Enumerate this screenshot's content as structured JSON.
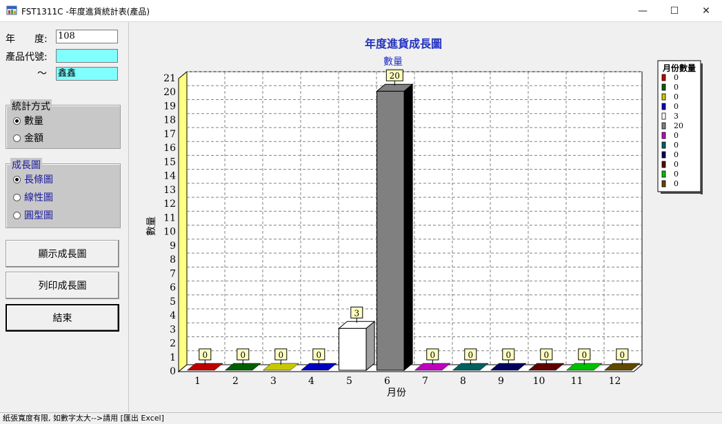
{
  "window": {
    "title": "FST1311C -年度進貨統計表(產品)",
    "minimize": "—",
    "maximize": "☐",
    "close": "✕"
  },
  "form": {
    "year_label": "年　　度:",
    "year_value": "108",
    "product_code_label": "產品代號:",
    "product_code_from": "",
    "tilde": "～",
    "product_code_to": "鑫鑫"
  },
  "stat_method": {
    "title": "統計方式",
    "options": [
      "數量",
      "金額"
    ],
    "selected": 0
  },
  "growth_chart": {
    "title": "成長圖",
    "options": [
      "長條圖",
      "線性圖",
      "圓型圖"
    ],
    "selected": 0
  },
  "buttons": {
    "show": "顯示成長圖",
    "print": "列印成長圖",
    "end": "結束"
  },
  "status": "紙張寬度有限, 如數字太大-->請用 [匯出 Excel]",
  "chart_data": {
    "type": "bar",
    "title": "年度進貨成長圖",
    "subtitle": "數量",
    "xlabel": "月份",
    "ylabel": "數量",
    "ylim": [
      0,
      21
    ],
    "categories": [
      "1",
      "2",
      "3",
      "4",
      "5",
      "6",
      "7",
      "8",
      "9",
      "10",
      "11",
      "12"
    ],
    "values": [
      0,
      0,
      0,
      0,
      3,
      20,
      0,
      0,
      0,
      0,
      0,
      0
    ],
    "colors": [
      "#c00000",
      "#006000",
      "#c8c800",
      "#0000c0",
      "#ffffff",
      "#808080",
      "#c000c0",
      "#006060",
      "#000060",
      "#600000",
      "#00c000",
      "#604800"
    ],
    "legend_title": "月份數量",
    "legend_placement": "right",
    "grid": true
  }
}
